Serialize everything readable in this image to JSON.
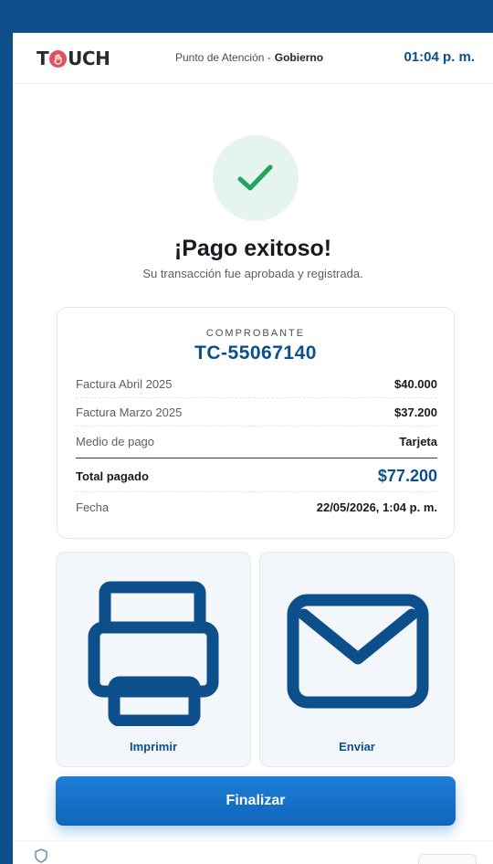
{
  "header": {
    "logo_left": "T",
    "logo_right": "UCH",
    "location_label": "Punto de Atención -",
    "location_name": "Gobierno",
    "time": "01:04 p. m."
  },
  "status": {
    "icon": "check-icon",
    "title": "¡Pago exitoso!",
    "subtitle": "Su transacción fue aprobada y registrada."
  },
  "receipt": {
    "label": "COMPROBANTE",
    "id": "TC-55067140",
    "items": [
      {
        "label": "Factura Abril 2025",
        "value": "$40.000"
      },
      {
        "label": "Factura Marzo 2025",
        "value": "$37.200"
      },
      {
        "label": "Medio de pago",
        "value": "Tarjeta"
      }
    ],
    "total_label": "Total pagado",
    "total_value": "$77.200",
    "date_label": "Fecha",
    "date_value": "22/05/2026, 1:04 p. m."
  },
  "actions": {
    "print_label": "Imprimir",
    "print_icon": "printer-icon",
    "send_label": "Enviar",
    "send_icon": "envelope-icon",
    "finish_label": "Finalizar"
  },
  "colors": {
    "brand_blue": "#0d4f8b",
    "success_green": "#22a45d",
    "button_blue": "#1670c9"
  }
}
